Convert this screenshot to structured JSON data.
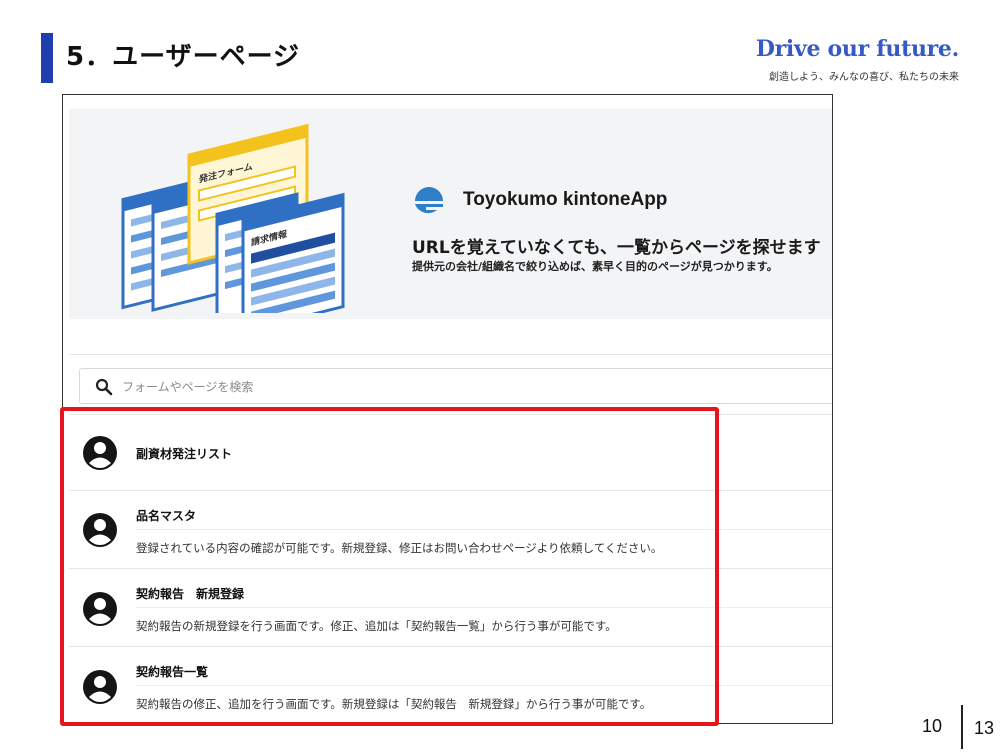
{
  "slide": {
    "title": "5．ユーザーページ",
    "brand": "Drive our future.",
    "tagline": "創造しよう、みんなの喜び、私たちの未来",
    "page_number": "10",
    "page_total": "13"
  },
  "app": {
    "name": "Toyokumo kintoneApp",
    "hero_title": "URLを覚えていなくても、一覧からページを探せます",
    "hero_subtitle": "提供元の会社/組織名で絞り込めば、素早く目的のページが見つかります。",
    "illustration_labels": [
      "発注フォーム",
      "請求情報"
    ]
  },
  "search": {
    "placeholder": "フォームやページを検索"
  },
  "pages": [
    {
      "name": "副資材発注リスト",
      "description": ""
    },
    {
      "name": "品名マスタ",
      "description": "登録されている内容の確認が可能です。新規登録、修正はお問い合わせページより依頼してください。"
    },
    {
      "name": "契約報告　新規登録",
      "description": "契約報告の新規登録を行う画面です。修正、追加は「契約報告一覧」から行う事が可能です。"
    },
    {
      "name": "契約報告一覧",
      "description": "契約報告の修正、追加を行う画面です。新規登録は「契約報告　新規登録」から行う事が可能です。"
    }
  ],
  "colors": {
    "accent_bar": "#1f3fae",
    "brand": "#3759c6",
    "highlight": "#e8141b",
    "illustration_blue": "#2f6fc4",
    "illustration_yellow": "#f4c21c"
  }
}
